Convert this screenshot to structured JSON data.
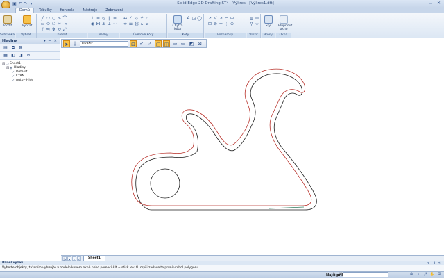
{
  "window": {
    "title": "Solid Edge 2D Drafting ST4 - Výkres - [Výkres1.dft]",
    "qat_icons": [
      "save-icon",
      "undo-icon",
      "redo-icon",
      "dropdown-icon"
    ],
    "controls": [
      "minimize-icon",
      "restore-icon",
      "close-icon"
    ],
    "icon_glyphs": {
      "save": "▣",
      "undo": "↶",
      "redo": "↷",
      "dropdown": "▾",
      "minimize": "–",
      "restore": "❐",
      "close": "✕"
    }
  },
  "ribbon": {
    "tabs": [
      {
        "label": "Domů",
        "active": true
      },
      {
        "label": "Tabulky",
        "active": false
      },
      {
        "label": "Kontrola",
        "active": false
      },
      {
        "label": "Nástroje",
        "active": false
      },
      {
        "label": "Zobrazení",
        "active": false
      }
    ],
    "groups": {
      "clipboard": {
        "label": "Schránka",
        "button": "Vložit"
      },
      "select": {
        "label": "Vybrat",
        "button": "Vybrat"
      },
      "draw": {
        "label": "Kreslit"
      },
      "relate": {
        "label": "Vazby"
      },
      "dimension": {
        "label": "Úvěrové kóty"
      },
      "annotation": {
        "label": "Kóty",
        "button": "Chytrá kóta"
      },
      "annotate": {
        "label": "Poznámky"
      },
      "insert": {
        "label": "Vložit"
      },
      "layers": {
        "label": "Brosy",
        "button": "Styl"
      },
      "sheet": {
        "label": "Okna",
        "button": "Přepnout okno"
      }
    }
  },
  "left_panel": {
    "title": "Hladiny",
    "header_icons": [
      "pin-icon",
      "close-icon"
    ],
    "tree": [
      {
        "label": "Sheet1",
        "indent": 0,
        "expand": "⊟"
      },
      {
        "label": "Hladiny",
        "indent": 1,
        "expand": "⊟"
      },
      {
        "label": "Default",
        "indent": 2,
        "expand": ""
      },
      {
        "label": "CYAN",
        "indent": 2,
        "expand": ""
      },
      {
        "label": "Auto - Hide",
        "indent": 2,
        "expand": ""
      }
    ]
  },
  "command_bar": {
    "selection_filter": "Uvažit",
    "buttons": [
      "select-arrow-icon",
      "filter-icon",
      "lock-icon",
      "check-icon",
      "rectangle-select-icon",
      "inside-icon",
      "overlap-icon",
      "outside-icon",
      "accept-icon",
      "cancel-icon"
    ]
  },
  "sheet_tabs": {
    "active": "Sheet1"
  },
  "prompt": {
    "title": "Panel výzev",
    "text": "Vyberte objekty, tažením vybírejte v obdélníkovém okně nebo pomocí Alt + stisk lev. tl. myši zadávejte první vrchol polygonu."
  },
  "status": {
    "find_label": "Najít příkaz"
  },
  "colors": {
    "outline_red": "#b9332c",
    "outline_dark": "#1c1c1c",
    "outline_green": "#2f7a5c"
  }
}
